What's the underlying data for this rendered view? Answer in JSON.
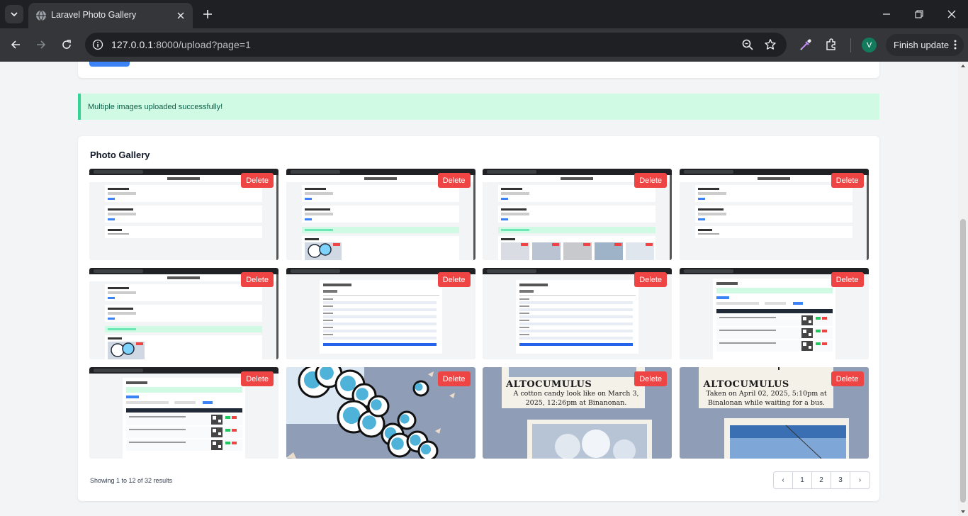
{
  "browser": {
    "tab_title": "Laravel Photo Gallery",
    "url_host": "127.0.0.1",
    "url_rest": ":8000/upload?page=1",
    "profile_initial": "V",
    "update_label": "Finish update"
  },
  "alert": {
    "message": "Multiple images uploaded successfully!"
  },
  "gallery": {
    "title": "Photo Gallery",
    "delete_label": "Delete",
    "photos": [
      {
        "kind": "screenshot-gallery"
      },
      {
        "kind": "screenshot-gallery-with-alert"
      },
      {
        "kind": "screenshot-gallery-with-photos"
      },
      {
        "kind": "screenshot-gallery"
      },
      {
        "kind": "screenshot-gallery-with-alert"
      },
      {
        "kind": "screenshot-form"
      },
      {
        "kind": "screenshot-form"
      },
      {
        "kind": "screenshot-table"
      },
      {
        "kind": "screenshot-table"
      },
      {
        "kind": "cloud-doodle"
      },
      {
        "kind": "altocumulus-note-1"
      },
      {
        "kind": "altocumulus-note-2"
      }
    ],
    "notes": {
      "altocumulus_1_heading": "ALTOCUMULUS",
      "altocumulus_1_text": "A cotton candy look like on March 3, 2025, 12:26pm at Binanonan.",
      "altocumulus_2_heading": "ALTOCUMULUS",
      "altocumulus_2_text": "Taken on April 02, 2025, 5:10pm at Binalonan while waiting for a bus."
    }
  },
  "pagination": {
    "summary": "Showing 1 to 12 of 32 results",
    "prev": "‹",
    "pages": [
      "1",
      "2",
      "3"
    ],
    "next": "›"
  },
  "colors": {
    "delete": "#ef4444",
    "alert_bg": "#d1fae5",
    "alert_border": "#34d399",
    "primary": "#3b82f6"
  }
}
